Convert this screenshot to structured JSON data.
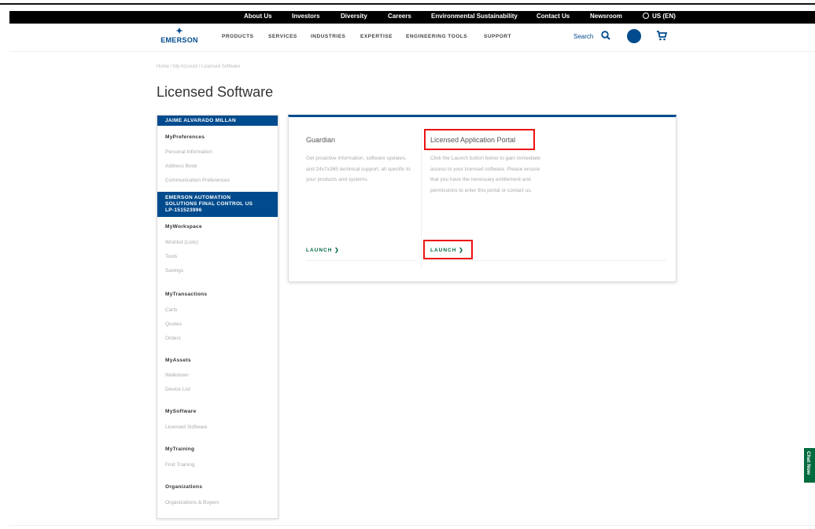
{
  "utility": {
    "about": "About Us",
    "investors": "Investors",
    "diversity": "Diversity",
    "careers": "Careers",
    "env": "Environmental Sustainability",
    "contact": "Contact Us",
    "newsroom": "Newsroom",
    "locale": "US (EN)"
  },
  "logo": {
    "text": "EMERSON"
  },
  "nav": {
    "products": "PRODUCTS",
    "services": "SERVICES",
    "industries": "INDUSTRIES",
    "expertise": "EXPERTISE",
    "engineering": "ENGINEERING TOOLS",
    "support": "SUPPORT",
    "search": "Search"
  },
  "breadcrumb": "Home  /  My Account  /  Licensed Software",
  "page_title": "Licensed Software",
  "sidebar": {
    "user_name": "JAIME ALVARADO MILLAN",
    "my_preferences": "MyPreferences",
    "personal_info": "Personal Information",
    "address_book": "Address Book",
    "comm_prefs": "Communication Preferences",
    "account_line1": "EMERSON AUTOMATION",
    "account_line2": "SOLUTIONS FINAL CONTROL US",
    "account_line3": "LP-151523996",
    "my_workspace": "MyWorkspace",
    "workspace_1": "Wishlist (Lists)",
    "workspace_2": "Tools",
    "workspace_3": "Savings",
    "my_transactions": "MyTransactions",
    "trans_1": "Carts",
    "trans_2": "Quotes",
    "trans_3": "Orders",
    "my_assets": "MyAssets",
    "assets_1": "Walkdown",
    "assets_2": "Device List",
    "my_software": "MySoftware",
    "software_1": "Licensed Software",
    "my_training": "MyTraining",
    "training_1": "Find Training",
    "organizations": "Organizations",
    "org_1": "Organizations & Buyers"
  },
  "cards": {
    "guardian_title": "Guardian",
    "guardian_desc": "Get proactive information, software updates, and 24x7x365 technical support, all specific to your products and systems.",
    "guardian_launch": "LAUNCH",
    "portal_title": "Licensed Application Portal",
    "portal_desc": "Click the Launch button below to gain immediate access to your licensed software. Please ensure that you have the necessary entitlement and permissions to enter this portal or contact us.",
    "portal_launch": "LAUNCH"
  },
  "chat": "Chat Now",
  "colors": {
    "brand_blue": "#004b8d",
    "accent_green": "#006b3f",
    "highlight_red": "#e11111"
  }
}
